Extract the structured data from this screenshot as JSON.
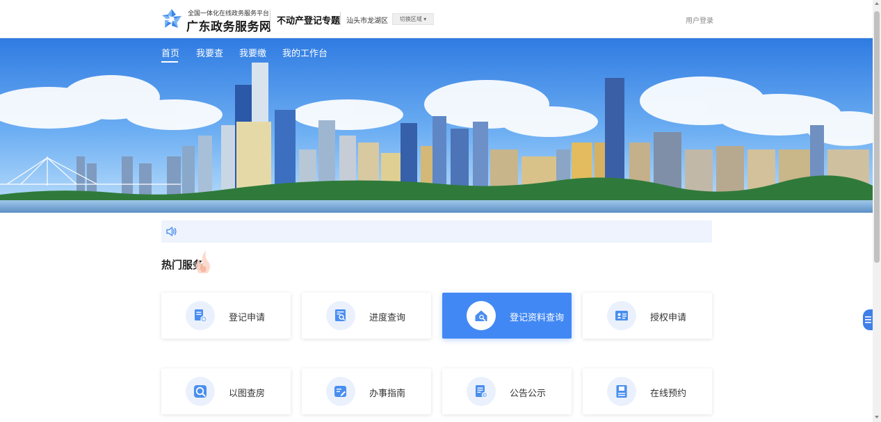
{
  "header": {
    "logo_subtitle": "全国一体化在线政务服务平台",
    "logo_title": "广东政务服务网",
    "topic_title": "不动产登记专题",
    "region_name": "汕头市龙湖区",
    "region_switch_label": "切换区域 ▾",
    "login_label": "用户登录"
  },
  "nav": {
    "items": [
      {
        "label": "首页"
      },
      {
        "label": "我要查"
      },
      {
        "label": "我要缴"
      },
      {
        "label": "我的工作台"
      }
    ],
    "active_index": 0
  },
  "notice": {
    "icon": "speaker-icon",
    "text": ""
  },
  "hot_services": {
    "title": "热门服务",
    "cards": [
      {
        "label": "登记申请",
        "icon": "apply-doc-icon",
        "active": false
      },
      {
        "label": "进度查询",
        "icon": "progress-search-icon",
        "active": false
      },
      {
        "label": "登记资料查询",
        "icon": "house-search-icon",
        "active": true
      },
      {
        "label": "授权申请",
        "icon": "id-card-icon",
        "active": false
      },
      {
        "label": "以图查房",
        "icon": "map-search-icon",
        "active": false
      },
      {
        "label": "办事指南",
        "icon": "guide-edit-icon",
        "active": false
      },
      {
        "label": "公告公示",
        "icon": "notice-doc-icon",
        "active": false
      },
      {
        "label": "在线预约",
        "icon": "appointment-icon",
        "active": false
      }
    ]
  },
  "colors": {
    "accent": "#4188f4",
    "card_icon_bg": "#eaf1fd",
    "notice_bg": "#eef3fd",
    "icon_blue": "#4a8ef0"
  }
}
